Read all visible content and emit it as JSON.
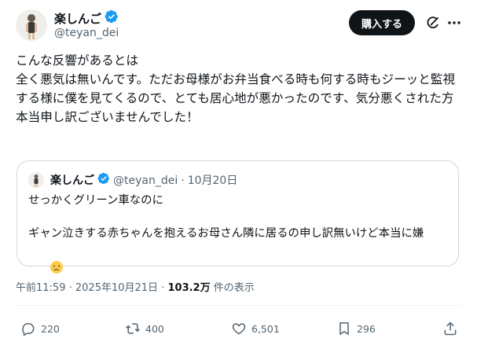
{
  "author": {
    "name": "楽しんご",
    "handle": "@teyan_dei"
  },
  "header": {
    "buy_label": "購入する"
  },
  "post": {
    "lines": [
      "こんな反響があるとは",
      "",
      "全く悪気は無いんです。ただお母様がお弁当食べる時も何する時もジーッと監視する様に僕を見てくるので、とても居心地が悪かったのです、気分悪くされた方本当申し訳ございませんでした！"
    ]
  },
  "quote": {
    "name": "楽しんご",
    "handle": "@teyan_dei",
    "separator": "·",
    "date": "10月20日",
    "line1": "せっかくグリーン車なのに",
    "line2": "ギャン泣きする赤ちゃんを抱えるお母さん隣に居るの申し訳無いけど本当に嫌",
    "emoji": "crying-face-icon"
  },
  "meta": {
    "time": "午前11:59",
    "sep1": "·",
    "date": "2025年10月21日",
    "sep2": "·",
    "views": "103.2万",
    "views_label": "件の表示"
  },
  "actions": {
    "replies": "220",
    "reposts": "400",
    "likes": "6,501",
    "bookmarks": "296"
  },
  "colors": {
    "text": "#0f1419",
    "secondary": "#536471",
    "verified": "#1d9bf0",
    "border": "#cfd9de"
  }
}
